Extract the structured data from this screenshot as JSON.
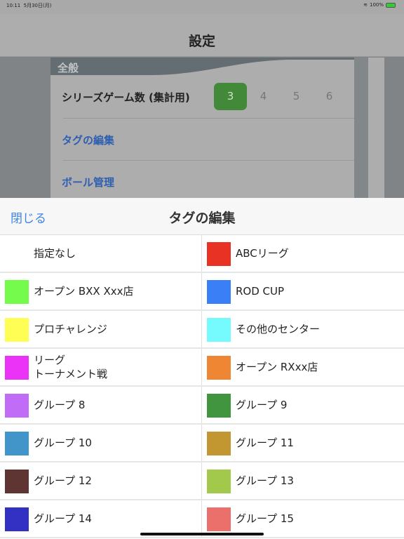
{
  "status": {
    "time": "10:11",
    "date": "5月30日(月)",
    "battery": "100%"
  },
  "nav": {
    "title": "設定"
  },
  "background": {
    "section": "全般",
    "series_label": "シリーズゲーム数 (集計用)",
    "series_options": [
      "3",
      "4",
      "5",
      "6"
    ],
    "series_selected": "3",
    "tag_edit": "タグの編集",
    "ball_manage": "ボール管理"
  },
  "sheet": {
    "close_label": "閉じる",
    "title": "タグの編集",
    "tags": [
      {
        "label": "指定なし",
        "color": ""
      },
      {
        "label": "ABCリーグ",
        "color": "#e83223"
      },
      {
        "label": "オープン BXX Xxx店",
        "color": "#75fb4c"
      },
      {
        "label": "ROD CUP",
        "color": "#3a7ff6"
      },
      {
        "label": "プロチャレンジ",
        "color": "#fffe55"
      },
      {
        "label": "その他のセンター",
        "color": "#75fbfd"
      },
      {
        "label": "リーグ\nトーナメント戦",
        "color": "#ea33f7"
      },
      {
        "label": "オープン RXxx店",
        "color": "#ee8633"
      },
      {
        "label": "グループ 8",
        "color": "#c16cf7"
      },
      {
        "label": "グループ 9",
        "color": "#41953f"
      },
      {
        "label": "グループ 10",
        "color": "#4195c9"
      },
      {
        "label": "グループ 11",
        "color": "#c29631"
      },
      {
        "label": "グループ 12",
        "color": "#5e3533"
      },
      {
        "label": "グループ 13",
        "color": "#a3c94c"
      },
      {
        "label": "グループ 14",
        "color": "#3331c4"
      },
      {
        "label": "グループ 15",
        "color": "#eb6f6a"
      }
    ]
  }
}
